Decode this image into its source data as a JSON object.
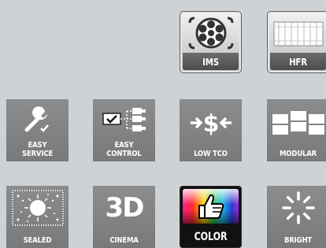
{
  "tiles": {
    "ims": {
      "label": "IMS",
      "icon": "film-reel-icon"
    },
    "hfr": {
      "label": "HFR",
      "icon": "film-frames-icon"
    },
    "easy_service": {
      "label": "EASY\nSERVICE",
      "icon": "wrench-icon"
    },
    "easy_control": {
      "label": "EASY\nCONTROL",
      "icon": "network-control-icon"
    },
    "low_tco": {
      "label": "LOW TCO",
      "icon": "dollar-arrows-icon"
    },
    "modular": {
      "label": "MODULAR",
      "icon": "modular-blocks-icon"
    },
    "sealed": {
      "label": "SEALED",
      "icon": "sealed-light-icon"
    },
    "cinema": {
      "label": "CINEMA",
      "icon_text": "3D",
      "icon": "3d-icon"
    },
    "color": {
      "label": "COLOR",
      "icon": "thumbs-up-icon"
    },
    "bright": {
      "label": "BRIGHT",
      "icon": "brightness-burst-icon"
    }
  },
  "colors": {
    "background": "#cfd2d5",
    "tile": "#808284",
    "tile_text": "#ffffff"
  }
}
